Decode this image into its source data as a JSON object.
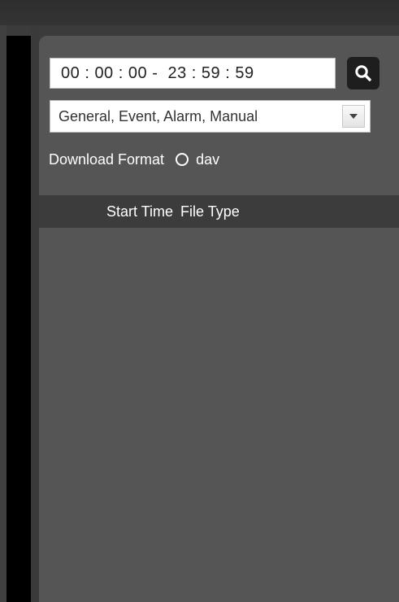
{
  "playback_panel": {
    "time_range": {
      "start_h": "00",
      "start_m": "00",
      "start_s": "00",
      "end_h": "23",
      "end_m": "59",
      "end_s": "59",
      "time_sep": ":",
      "range_sep": "-"
    },
    "search_icon": "search-icon",
    "record_type": {
      "selected": "General, Event, Alarm, Manual"
    },
    "download_format": {
      "label": "Download Format",
      "option_label": "dav",
      "selected": false
    },
    "table": {
      "columns": [
        "Start Time",
        "File Type"
      ],
      "rows": []
    }
  }
}
